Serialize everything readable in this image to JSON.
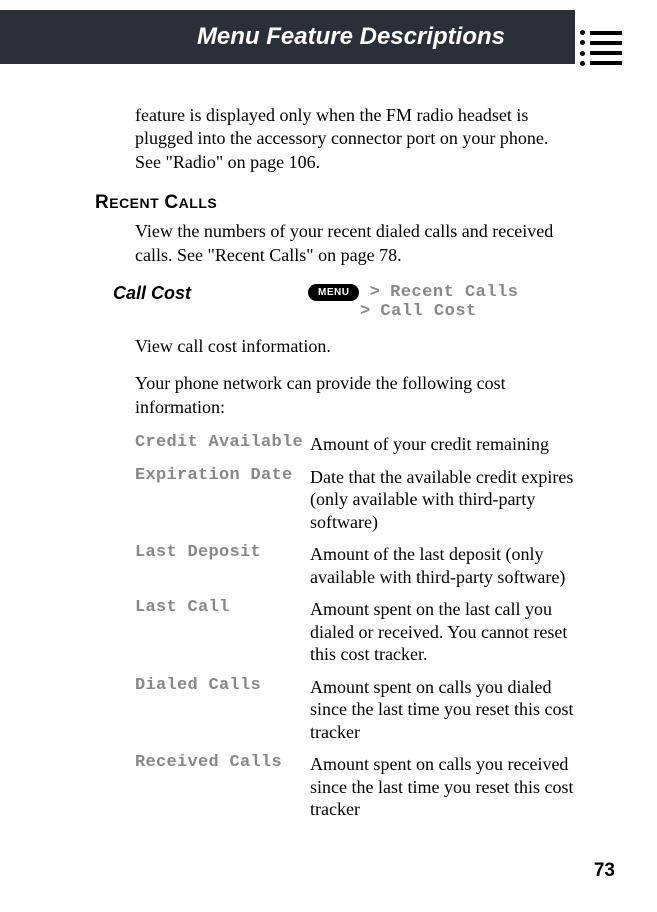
{
  "header": {
    "title": "Menu Feature Descriptions"
  },
  "intro": "feature is displayed only when the FM radio headset is plugged into the accessory connector port on your phone. See \"Radio\" on page 106.",
  "section": {
    "heading_first": "R",
    "heading_rest1": "ECENT",
    "heading_space": " ",
    "heading_first2": "C",
    "heading_rest2": "ALLS",
    "desc": "View the numbers of your recent dialed calls and received calls. See \"Recent Calls\" on page 78."
  },
  "subsection": {
    "title": "Call Cost",
    "menu_label": "MENU",
    "path_sep1": " > ",
    "path1": "Recent Calls",
    "path_sep2": "> ",
    "path2": "Call Cost",
    "body1": "View call cost information.",
    "body2": "Your phone network can provide the following cost information:"
  },
  "definitions": [
    {
      "term": "Credit Available",
      "desc": "Amount of your credit remaining"
    },
    {
      "term": "Expiration Date",
      "desc": "Date that the available credit expires (only available with third-party software)"
    },
    {
      "term": "Last Deposit",
      "desc": "Amount of the last deposit (only available with third-party software)"
    },
    {
      "term": "Last Call",
      "desc": "Amount spent on the last call you dialed or received. You cannot reset this cost tracker."
    },
    {
      "term": "Dialed Calls",
      "desc": "Amount spent on calls you dialed since the last time you reset this cost tracker"
    },
    {
      "term": "Received Calls",
      "desc": "Amount spent on calls you received since the last time you reset this cost tracker"
    }
  ],
  "page_number": "73"
}
